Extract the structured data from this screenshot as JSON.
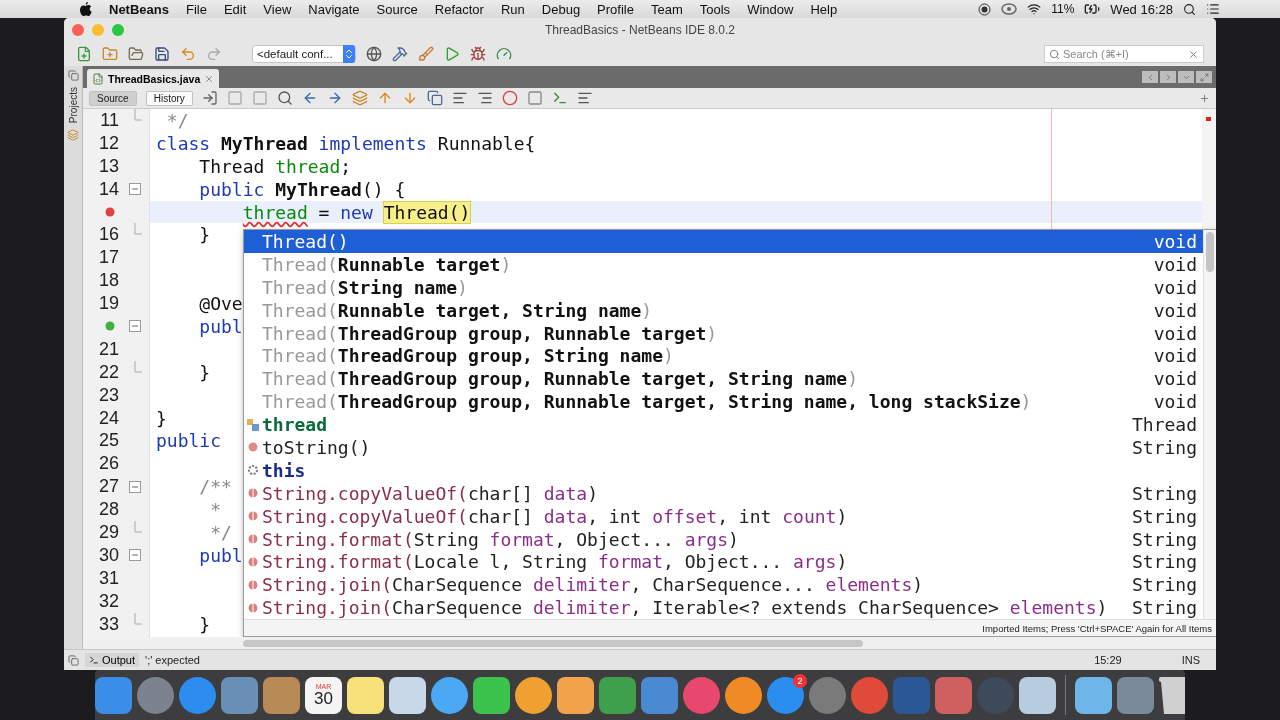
{
  "menu_bar": {
    "app": "NetBeans",
    "menus": [
      "File",
      "Edit",
      "View",
      "Navigate",
      "Source",
      "Refactor",
      "Run",
      "Debug",
      "Profile",
      "Team",
      "Tools",
      "Window",
      "Help"
    ],
    "battery": "11%",
    "clock": "Wed 16:28"
  },
  "window": {
    "title": "ThreadBasics - NetBeans IDE 8.0.2"
  },
  "toolbar": {
    "configuration": "<default conf...",
    "search": {
      "placeholder": "Search (⌘+I)"
    }
  },
  "side_tab": "Projects",
  "tabs": [
    {
      "label": "ThreadBasics.java",
      "selected": true
    }
  ],
  "view_buttons": [
    {
      "label": "Source",
      "selected": true
    },
    {
      "label": "History",
      "selected": false
    }
  ],
  "editor": {
    "lines": [
      {
        "number": "11",
        "fold_end": true,
        "tokens": [
          {
            "t": " */",
            "kind": "comment"
          }
        ]
      },
      {
        "number": "12",
        "tokens": [
          {
            "t": "class ",
            "kind": "keyword"
          },
          {
            "t": "MyThread",
            "kind": "bold"
          },
          {
            "t": " implements ",
            "kind": "keyword"
          },
          {
            "t": "Runnable{",
            "kind": "plain"
          }
        ]
      },
      {
        "number": "13",
        "tokens": [
          {
            "t": "    Thread ",
            "kind": "plain"
          },
          {
            "t": "thread",
            "kind": "field"
          },
          {
            "t": ";",
            "kind": "plain"
          }
        ]
      },
      {
        "number": "14",
        "fold_start": true,
        "tokens": [
          {
            "t": "    public ",
            "kind": "keyword"
          },
          {
            "t": "MyThread",
            "kind": "bold"
          },
          {
            "t": "() {",
            "kind": "plain"
          }
        ]
      },
      {
        "error": true,
        "current": true,
        "tokens": [
          {
            "t": "        thread",
            "kind": "field_error"
          },
          {
            "t": " = ",
            "kind": "plain"
          },
          {
            "t": "new ",
            "kind": "keyword"
          },
          {
            "t": "Thread()",
            "kind": "match"
          }
        ]
      },
      {
        "number": "16",
        "fold_end": true,
        "tokens": [
          {
            "t": "    }",
            "kind": "plain"
          }
        ]
      },
      {
        "number": "17"
      },
      {
        "number": "18"
      },
      {
        "number": "19",
        "tokens": [
          {
            "t": "    @Ove",
            "kind": "plain"
          }
        ]
      },
      {
        "override": true,
        "fold_start": true,
        "tokens": [
          {
            "t": "    publ",
            "kind": "keyword"
          }
        ]
      },
      {
        "number": "21"
      },
      {
        "number": "22",
        "fold_end": true,
        "tokens": [
          {
            "t": "    }",
            "kind": "plain"
          }
        ]
      },
      {
        "number": "23"
      },
      {
        "number": "24",
        "tokens": [
          {
            "t": "}",
            "kind": "plain"
          }
        ]
      },
      {
        "number": "25",
        "tokens": [
          {
            "t": "public",
            "kind": "keyword"
          }
        ]
      },
      {
        "number": "26"
      },
      {
        "number": "27",
        "fold_start": true,
        "tokens": [
          {
            "t": "    /**",
            "kind": "comment"
          }
        ]
      },
      {
        "number": "28",
        "tokens": [
          {
            "t": "     *",
            "kind": "comment"
          }
        ]
      },
      {
        "number": "29",
        "fold_end": true,
        "tokens": [
          {
            "t": "     */",
            "kind": "comment"
          }
        ]
      },
      {
        "number": "30",
        "fold_start": true,
        "tokens": [
          {
            "t": "    publ",
            "kind": "keyword"
          }
        ]
      },
      {
        "number": "31"
      },
      {
        "number": "32"
      },
      {
        "number": "33",
        "fold_end": true,
        "tokens": [
          {
            "t": "    }",
            "kind": "plain"
          }
        ]
      }
    ]
  },
  "completion": {
    "items": [
      {
        "kind": "constructor",
        "tokens": [
          {
            "t": "Thread()",
            "kind": "dim"
          }
        ],
        "type": "void",
        "selected": true
      },
      {
        "kind": "constructor",
        "tokens": [
          {
            "t": "Thread(",
            "kind": "dim"
          },
          {
            "t": "Runnable target",
            "kind": "bold"
          },
          {
            "t": ")",
            "kind": "dim"
          }
        ],
        "type": "void",
        "selected": false
      },
      {
        "kind": "constructor",
        "tokens": [
          {
            "t": "Thread(",
            "kind": "dim"
          },
          {
            "t": "String name",
            "kind": "bold"
          },
          {
            "t": ")",
            "kind": "dim"
          }
        ],
        "type": "void",
        "selected": false
      },
      {
        "kind": "constructor",
        "tokens": [
          {
            "t": "Thread(",
            "kind": "dim"
          },
          {
            "t": "Runnable target, String name",
            "kind": "bold"
          },
          {
            "t": ")",
            "kind": "dim"
          }
        ],
        "type": "void",
        "selected": false
      },
      {
        "kind": "constructor",
        "tokens": [
          {
            "t": "Thread(",
            "kind": "dim"
          },
          {
            "t": "ThreadGroup group, Runnable target",
            "kind": "bold"
          },
          {
            "t": ")",
            "kind": "dim"
          }
        ],
        "type": "void",
        "selected": false
      },
      {
        "kind": "constructor",
        "tokens": [
          {
            "t": "Thread(",
            "kind": "dim"
          },
          {
            "t": "ThreadGroup group, String name",
            "kind": "bold"
          },
          {
            "t": ")",
            "kind": "dim"
          }
        ],
        "type": "void",
        "selected": false
      },
      {
        "kind": "constructor",
        "tokens": [
          {
            "t": "Thread(",
            "kind": "dim"
          },
          {
            "t": "ThreadGroup group, Runnable target, String name",
            "kind": "bold"
          },
          {
            "t": ")",
            "kind": "dim"
          }
        ],
        "type": "void",
        "selected": false
      },
      {
        "kind": "constructor",
        "tokens": [
          {
            "t": "Thread(",
            "kind": "dim"
          },
          {
            "t": "ThreadGroup group, Runnable target, String name, long stackSize",
            "kind": "bold"
          },
          {
            "t": ")",
            "kind": "dim"
          }
        ],
        "type": "void",
        "selected": false
      },
      {
        "kind": "field",
        "tokens": [
          {
            "t": "thread",
            "kind": "field"
          }
        ],
        "type": "Thread",
        "selected": false
      },
      {
        "kind": "method",
        "tokens": [
          {
            "t": "toString()",
            "kind": "plain"
          }
        ],
        "type": "String",
        "selected": false
      },
      {
        "kind": "keyword",
        "tokens": [
          {
            "t": "this",
            "kind": "keyword"
          }
        ],
        "selected": false
      },
      {
        "kind": "static",
        "tokens": [
          {
            "t": "String.copyValueOf(",
            "kind": "method"
          },
          {
            "t": "char[] ",
            "kind": "plain"
          },
          {
            "t": "data",
            "kind": "param"
          },
          {
            "t": ")",
            "kind": "plain"
          }
        ],
        "type": "String",
        "selected": false
      },
      {
        "kind": "static",
        "tokens": [
          {
            "t": "String.copyValueOf(",
            "kind": "method"
          },
          {
            "t": "char[] ",
            "kind": "plain"
          },
          {
            "t": "data",
            "kind": "param"
          },
          {
            "t": ", int ",
            "kind": "plain"
          },
          {
            "t": "offset",
            "kind": "param"
          },
          {
            "t": ", int ",
            "kind": "plain"
          },
          {
            "t": "count",
            "kind": "param"
          },
          {
            "t": ")",
            "kind": "plain"
          }
        ],
        "type": "String",
        "selected": false
      },
      {
        "kind": "static",
        "tokens": [
          {
            "t": "String.format(",
            "kind": "method"
          },
          {
            "t": "String ",
            "kind": "plain"
          },
          {
            "t": "format",
            "kind": "param"
          },
          {
            "t": ", Object... ",
            "kind": "plain"
          },
          {
            "t": "args",
            "kind": "param"
          },
          {
            "t": ")",
            "kind": "plain"
          }
        ],
        "type": "String",
        "selected": false
      },
      {
        "kind": "static",
        "tokens": [
          {
            "t": "String.format(",
            "kind": "method"
          },
          {
            "t": "Locale l, String ",
            "kind": "plain"
          },
          {
            "t": "format",
            "kind": "param"
          },
          {
            "t": ", Object... ",
            "kind": "plain"
          },
          {
            "t": "args",
            "kind": "param"
          },
          {
            "t": ")",
            "kind": "plain"
          }
        ],
        "type": "String",
        "selected": false
      },
      {
        "kind": "static",
        "tokens": [
          {
            "t": "String.join(",
            "kind": "method"
          },
          {
            "t": "CharSequence ",
            "kind": "plain"
          },
          {
            "t": "delimiter",
            "kind": "param"
          },
          {
            "t": ", CharSequence... ",
            "kind": "plain"
          },
          {
            "t": "elements",
            "kind": "param"
          },
          {
            "t": ")",
            "kind": "plain"
          }
        ],
        "type": "String",
        "selected": false
      },
      {
        "kind": "static",
        "tokens": [
          {
            "t": "String.join(",
            "kind": "method"
          },
          {
            "t": "CharSequence ",
            "kind": "plain"
          },
          {
            "t": "delimiter",
            "kind": "param"
          },
          {
            "t": ", Iterable<? extends CharSequence> ",
            "kind": "plain"
          },
          {
            "t": "elements",
            "kind": "param"
          },
          {
            "t": ")",
            "kind": "plain"
          }
        ],
        "type": "String",
        "selected": false
      }
    ],
    "footer": "Imported Items; Press 'Ctrl+SPACE' Again for All Items"
  },
  "status_bar": {
    "output": "Output",
    "message": "';' expected",
    "position": "15:29",
    "mode": "INS"
  },
  "dock": [
    {
      "kind": "tile",
      "color": "#3a8ee6"
    },
    {
      "kind": "round",
      "color": "#7d838e"
    },
    {
      "kind": "round",
      "color": "#2d8cf0"
    },
    {
      "kind": "tile",
      "color": "#6a8fb5"
    },
    {
      "kind": "tile",
      "color": "#b88a55"
    },
    {
      "kind": "calendar",
      "month": "MAR",
      "day": "30",
      "color": "#f4f4f4"
    },
    {
      "kind": "tile",
      "color": "#f7e27a"
    },
    {
      "kind": "tile",
      "color": "#c8d8e8"
    },
    {
      "kind": "round",
      "color": "#4aa8f5"
    },
    {
      "kind": "tile",
      "color": "#3cc34e"
    },
    {
      "kind": "round",
      "color": "#f0a030"
    },
    {
      "kind": "tile",
      "color": "#f2a24a"
    },
    {
      "kind": "tile",
      "color": "#3ea04a"
    },
    {
      "kind": "tile",
      "color": "#4a8ad0"
    },
    {
      "kind": "round",
      "color": "#e8486e"
    },
    {
      "kind": "round",
      "color": "#f08a24"
    },
    {
      "kind": "round",
      "color": "#2a8ef0",
      "badge": "2"
    },
    {
      "kind": "round",
      "color": "#7a7a7a"
    },
    {
      "kind": "round",
      "color": "#e04a3a"
    },
    {
      "kind": "tile",
      "color": "#2b5797"
    },
    {
      "kind": "tile",
      "color": "#d06060"
    },
    {
      "kind": "round",
      "color": "#3c4a5a"
    },
    {
      "kind": "tile",
      "color": "#b8cce0"
    },
    {
      "kind": "separator"
    },
    {
      "kind": "tile",
      "color": "#6fb6e8"
    },
    {
      "kind": "tile",
      "color": "#7a8a9a"
    },
    {
      "kind": "trash",
      "color": "#d0d0d0"
    }
  ]
}
